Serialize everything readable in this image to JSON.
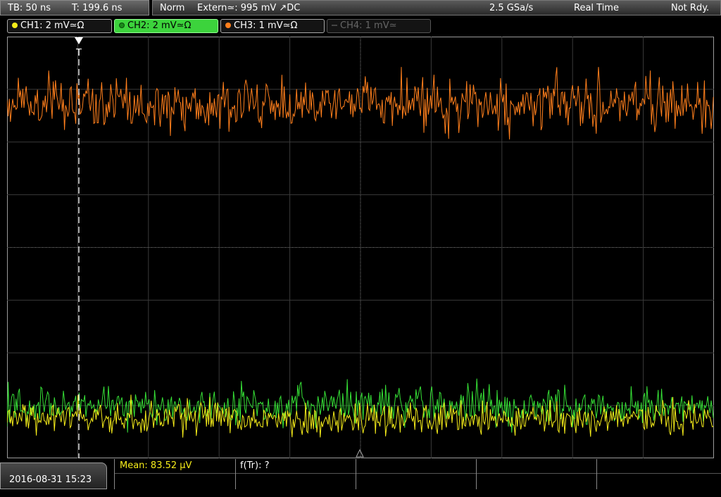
{
  "timebase": {
    "tb": "TB: 50 ns",
    "trig_time": "T: 199.6 ns"
  },
  "status": {
    "mode": "Norm",
    "trigger": "Extern≃: 995 mV ↗DC",
    "sample_rate": "2.5 GSa/s",
    "acq_mode": "Real Time",
    "state": "Not Rdy."
  },
  "channels": [
    {
      "label": "CH1: 2 mV≃Ω",
      "color": "#f5ec1a"
    },
    {
      "label": "CH2: 2 mV≃Ω",
      "color": "#36e036"
    },
    {
      "label": "CH3: 1 mV≃Ω",
      "color": "#ff7f1c"
    },
    {
      "label": "CH4: 1 mV≃",
      "color": "#666666"
    }
  ],
  "trigger_marker": "T",
  "measurements": {
    "mean": "Mean: 83.52 µV",
    "freq": "f(Tr): ?"
  },
  "datetime": "2016-08-31 15:23",
  "traces": [
    {
      "name": "CH3",
      "color": "#ff7f1c",
      "level": 0.16,
      "amplitude": 0.055
    },
    {
      "name": "CH2",
      "color": "#36e036",
      "level": 0.875,
      "amplitude": 0.04
    },
    {
      "name": "CH1",
      "color": "#f5ec1a",
      "level": 0.905,
      "amplitude": 0.035
    }
  ]
}
